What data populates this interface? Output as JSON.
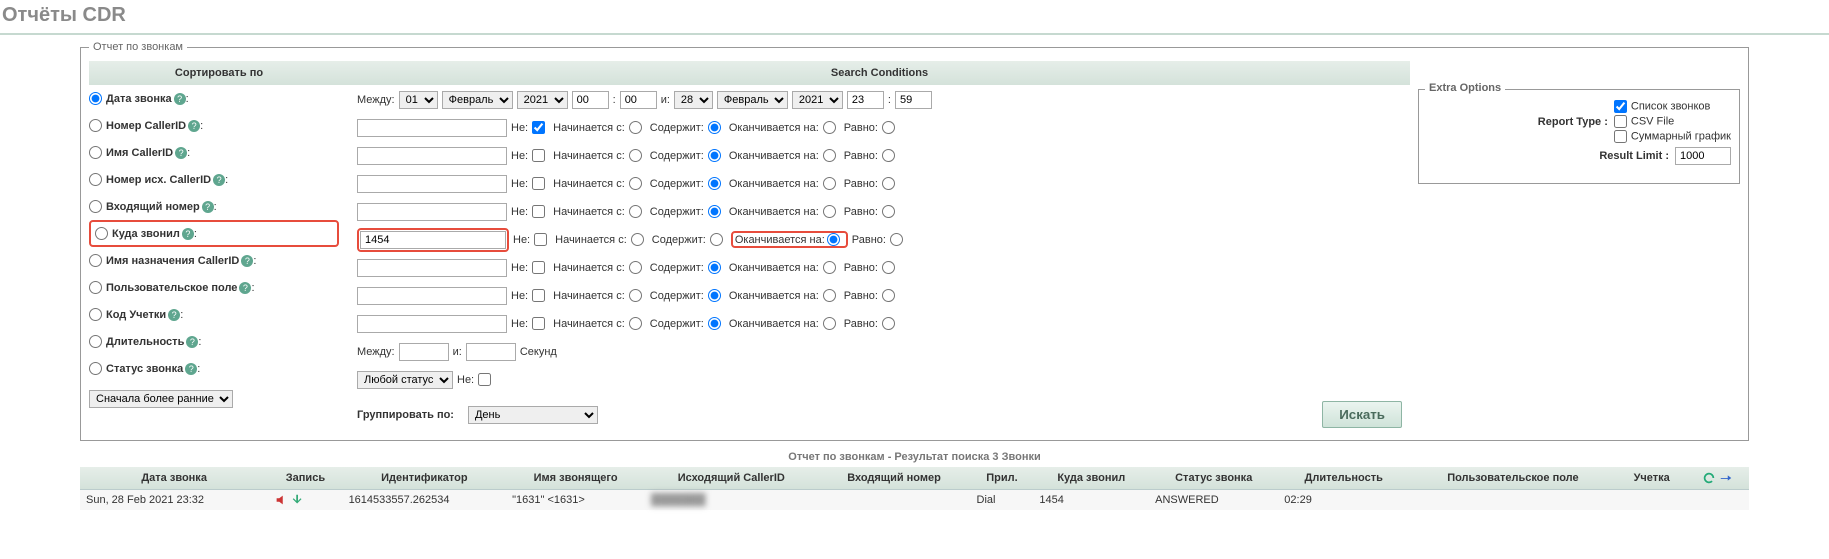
{
  "page_title": "Отчёты CDR",
  "fieldset_title": "Отчет по звонкам",
  "sort_header": "Сортировать по",
  "search_header": "Search Conditions",
  "extra_header": "Extra Options",
  "sort_items": [
    "Дата звонка",
    "Номер CallerID",
    "Имя CallerID",
    "Номер исх. CallerID",
    "Входящий номер",
    "Куда звонил",
    "Имя назначения CallerID",
    "Пользовательское поле",
    "Код Учетки",
    "Длительность",
    "Статус звонка"
  ],
  "between_label": "Между:",
  "and_label": "и:",
  "date_from": {
    "day": "01",
    "month": "Февраль",
    "year": "2021",
    "hh": "00",
    "mm": "00"
  },
  "date_to": {
    "day": "28",
    "month": "Февраль",
    "year": "2021",
    "hh": "23",
    "mm": "59"
  },
  "filter_labels": {
    "not": "Не:",
    "begins": "Начинается с:",
    "contains": "Содержит:",
    "ends": "Оканчивается на:",
    "equals": "Равно:"
  },
  "filter_rows": [
    {
      "value": "",
      "not": true,
      "sel": "contains"
    },
    {
      "value": "",
      "not": false,
      "sel": "contains"
    },
    {
      "value": "",
      "not": false,
      "sel": "contains"
    },
    {
      "value": "",
      "not": false,
      "sel": "contains"
    },
    {
      "value": "1454",
      "not": false,
      "sel": "ends",
      "hl": true
    },
    {
      "value": "",
      "not": false,
      "sel": "contains"
    },
    {
      "value": "",
      "not": false,
      "sel": "contains"
    },
    {
      "value": "",
      "not": false,
      "sel": "contains"
    }
  ],
  "duration_between": "Между:",
  "duration_and": "и:",
  "duration_seconds": "Секунд",
  "status_any": "Любой статус",
  "status_not": "Не:",
  "order_select": "Сначала более ранние",
  "group_by_label": "Группировать по:",
  "group_by_value": "День",
  "search_btn": "Искать",
  "extra": {
    "report_type": "Report Type :",
    "call_list": "Список звонков",
    "csv": "СSV File",
    "summary": "Суммарный график",
    "result_limit_label": "Result Limit :",
    "result_limit_value": "1000"
  },
  "result_title": "Отчет по звонкам - Результат поиска 3 Звонки",
  "result_columns": [
    "Дата звонка",
    "Запись",
    "Идентификатор",
    "Имя звонящего",
    "Исходящий CallerID",
    "Входящий номер",
    "Прил.",
    "Куда звонил",
    "Статус звонка",
    "Длительность",
    "Пользовательское поле",
    "Учетка",
    ""
  ],
  "result_rows": [
    {
      "date": "Sun, 28 Feb 2021 23:32",
      "id": "1614533557.262534",
      "caller": "\"1631\" <1631>",
      "out_clid": "███████",
      "did": "",
      "app": "Dial",
      "dst": "1454",
      "status": "ANSWERED",
      "duration": "02:29",
      "userfield": "",
      "account": ""
    }
  ]
}
